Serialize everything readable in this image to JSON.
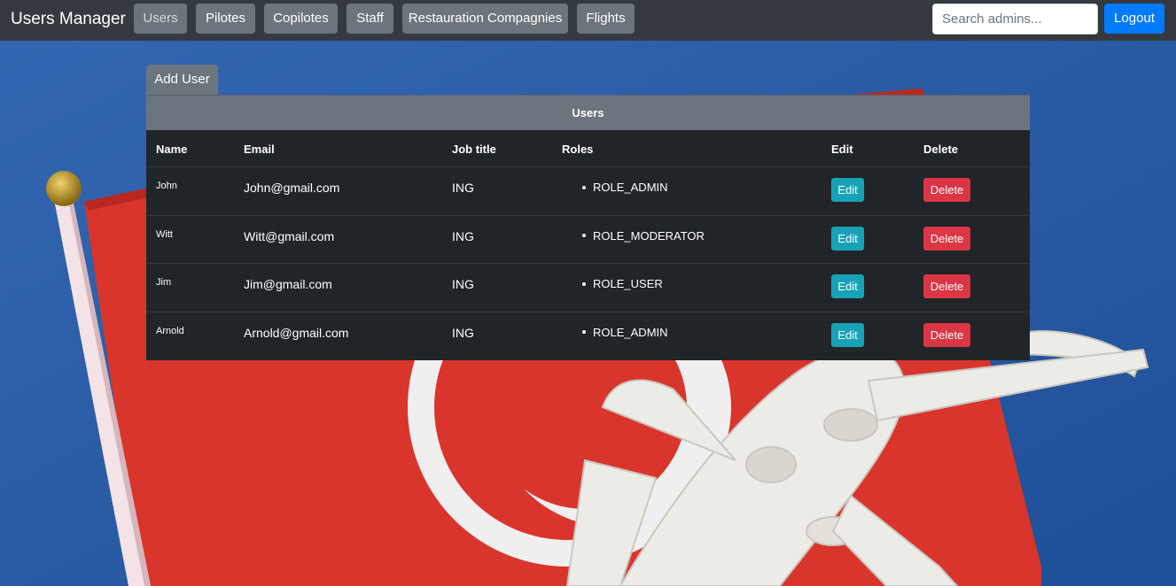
{
  "navbar": {
    "brand": "Users Manager",
    "items": [
      {
        "label": "Users",
        "active": true
      },
      {
        "label": "Pilotes"
      },
      {
        "label": "Copilotes"
      },
      {
        "label": "Staff"
      },
      {
        "label": "Restauration Compagnies"
      },
      {
        "label": "Flights"
      }
    ],
    "search_placeholder": "Search admins...",
    "logout_label": "Logout"
  },
  "add_user_label": "Add User",
  "table": {
    "caption": "Users",
    "headers": {
      "name": "Name",
      "email": "Email",
      "job_title": "Job title",
      "roles": "Roles",
      "edit": "Edit",
      "delete": "Delete"
    },
    "rows": [
      {
        "name": "John",
        "email": "John@gmail.com",
        "job_title": "ING",
        "role": "ROLE_ADMIN",
        "edit_label": "Edit",
        "delete_label": "Delete"
      },
      {
        "name": "Witt",
        "email": "Witt@gmail.com",
        "job_title": "ING",
        "role": "ROLE_MODERATOR",
        "edit_label": "Edit",
        "delete_label": "Delete"
      },
      {
        "name": "Jim",
        "email": "Jim@gmail.com",
        "job_title": "ING",
        "role": "ROLE_USER",
        "edit_label": "Edit",
        "delete_label": "Delete"
      },
      {
        "name": "Arnold",
        "email": "Arnold@gmail.com",
        "job_title": "ING",
        "role": "ROLE_ADMIN",
        "edit_label": "Edit",
        "delete_label": "Delete"
      }
    ]
  },
  "colors": {
    "navbar_bg": "#343a40",
    "secondary": "#6c757d",
    "primary": "#007bff",
    "info": "#17a2b8",
    "danger": "#dc3545",
    "table_bg": "#212529",
    "background_blue": "#2a5ea8",
    "flag_red": "#d9352c"
  },
  "background_image": {
    "icons": [
      "tunisia-flag-icon",
      "airplane-icon"
    ]
  }
}
